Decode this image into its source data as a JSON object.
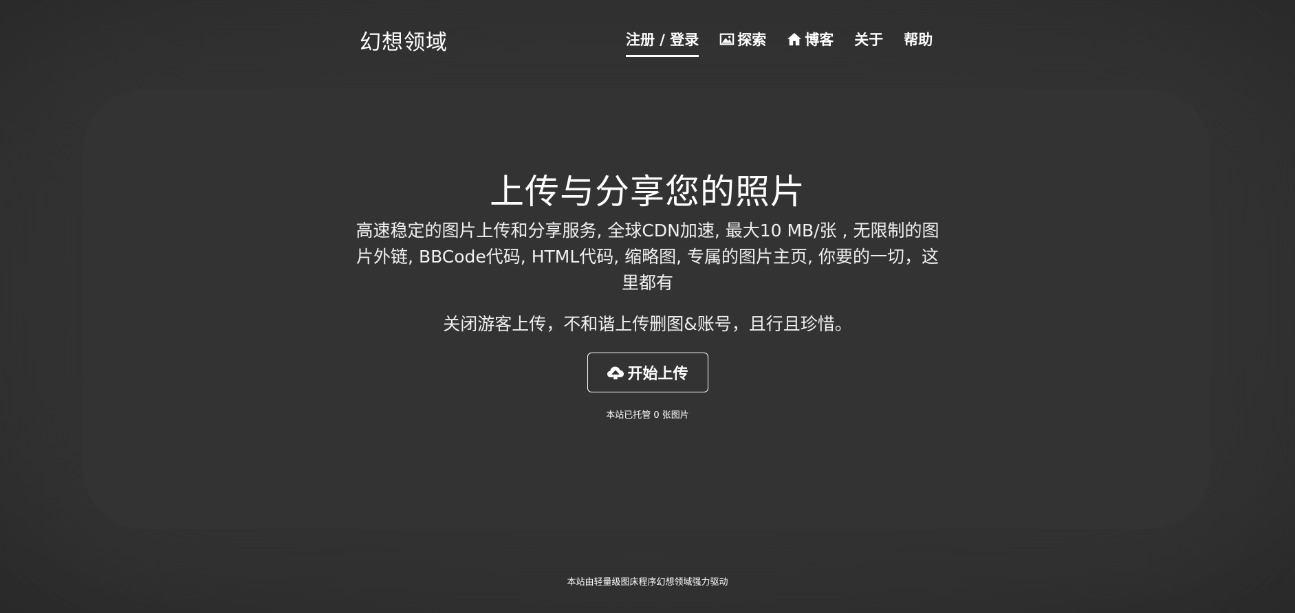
{
  "header": {
    "brand": "幻想领域",
    "nav": [
      {
        "label": "注册 / 登录",
        "icon": "",
        "active": true
      },
      {
        "label": "探索",
        "icon": "image-icon",
        "active": false
      },
      {
        "label": "博客",
        "icon": "home-icon",
        "active": false
      },
      {
        "label": "关于",
        "icon": "",
        "active": false
      },
      {
        "label": "帮助",
        "icon": "",
        "active": false
      }
    ]
  },
  "hero": {
    "title": "上传与分享您的照片",
    "description": "高速稳定的图片上传和分享服务, 全球CDN加速, 最大10 MB/张 , 无限制的图片外链, BBCode代码, HTML代码, 缩略图, 专属的图片主页, 你要的一切，这里都有",
    "notice": "关闭游客上传，不和谐上传删图&账号，且行且珍惜。",
    "upload_button": {
      "label": "开始上传",
      "icon": "cloud-upload-icon"
    },
    "hosted_count": "本站已托管 0 张图片"
  },
  "footer": {
    "text": "本站由轻量级图床程序幻想领域强力驱动"
  },
  "colors": {
    "background": "#333333",
    "text": "#ffffff"
  }
}
